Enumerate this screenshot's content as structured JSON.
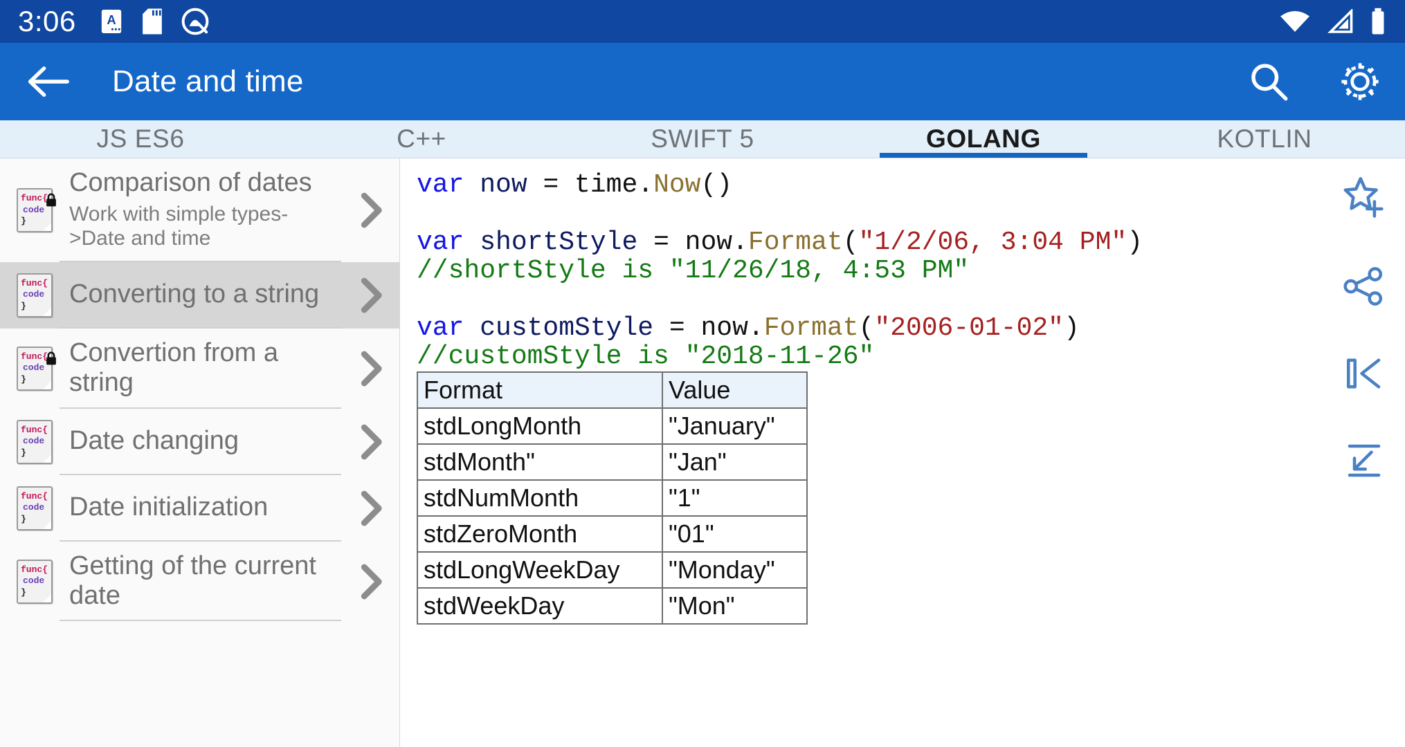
{
  "status_bar": {
    "clock": "3:06",
    "icons": [
      "keyboard-language-icon",
      "sd-card-icon",
      "app-circle-icon"
    ],
    "right_icons": [
      "wifi-icon",
      "cell-signal-icon",
      "battery-icon"
    ],
    "background": "#0F47A1"
  },
  "app_bar": {
    "back_label": "←",
    "title": "Date and time",
    "search_label": "search-icon",
    "settings_label": "gear-icon",
    "background": "#1668C8"
  },
  "tabs": {
    "active_index": 3,
    "accent": "#1565C0",
    "items": [
      {
        "label": "JS ES6"
      },
      {
        "label": "C++"
      },
      {
        "label": "SWIFT 5"
      },
      {
        "label": "GOLANG"
      },
      {
        "label": "KOTLIN"
      }
    ]
  },
  "sidebar": {
    "items": [
      {
        "title": "Comparison of dates",
        "subtitle": "Work with simple types->Date and time",
        "locked": true,
        "selected": false
      },
      {
        "title": "Converting to a string",
        "subtitle": "",
        "locked": false,
        "selected": true
      },
      {
        "title": "Convertion from a string",
        "subtitle": "",
        "locked": true,
        "selected": false
      },
      {
        "title": "Date changing",
        "subtitle": "",
        "locked": false,
        "selected": false
      },
      {
        "title": "Date initialization",
        "subtitle": "",
        "locked": false,
        "selected": false
      },
      {
        "title": "Getting of the current date",
        "subtitle": "",
        "locked": false,
        "selected": false
      }
    ],
    "icon_lines": {
      "l1": "func{",
      "l2": "code",
      "l3": "}"
    },
    "chevron": "chevron-right-icon"
  },
  "code": {
    "language": "GOLANG",
    "lines": [
      [
        {
          "t": "var ",
          "c": "kw"
        },
        {
          "t": "now ",
          "c": "id"
        },
        {
          "t": "= ",
          "c": "pl"
        },
        {
          "t": "time.",
          "c": "pl"
        },
        {
          "t": "Now",
          "c": "fn"
        },
        {
          "t": "()",
          "c": "pl"
        }
      ],
      [],
      [
        {
          "t": "var ",
          "c": "kw"
        },
        {
          "t": "shortStyle ",
          "c": "id"
        },
        {
          "t": "= ",
          "c": "pl"
        },
        {
          "t": "now.",
          "c": "pl"
        },
        {
          "t": "Format",
          "c": "fn"
        },
        {
          "t": "(",
          "c": "pl"
        },
        {
          "t": "\"1/2/06, 3:04 PM\"",
          "c": "str"
        },
        {
          "t": ")",
          "c": "pl"
        }
      ],
      [
        {
          "t": "//shortStyle is \"11/26/18, 4:53 PM\"",
          "c": "cmt"
        }
      ],
      [],
      [
        {
          "t": "var ",
          "c": "kw"
        },
        {
          "t": "customStyle ",
          "c": "id"
        },
        {
          "t": "= ",
          "c": "pl"
        },
        {
          "t": "now.",
          "c": "pl"
        },
        {
          "t": "Format",
          "c": "fn"
        },
        {
          "t": "(",
          "c": "pl"
        },
        {
          "t": "\"2006-01-02\"",
          "c": "str"
        },
        {
          "t": ")",
          "c": "pl"
        }
      ],
      [
        {
          "t": "//customStyle is \"2018-11-26\"",
          "c": "cmt"
        }
      ]
    ]
  },
  "format_table": {
    "headers": [
      "Format",
      "Value"
    ],
    "rows": [
      [
        "stdLongMonth",
        "\"January\""
      ],
      [
        "stdMonth\"",
        "\"Jan\""
      ],
      [
        "stdNumMonth",
        "\"1\""
      ],
      [
        "stdZeroMonth",
        "\"01\""
      ],
      [
        "stdLongWeekDay",
        "\"Monday\""
      ],
      [
        "stdWeekDay",
        "\"Mon\""
      ]
    ]
  },
  "action_rail": {
    "accent": "#4A80C4",
    "buttons": [
      {
        "name": "add-to-favorites-icon"
      },
      {
        "name": "share-icon"
      },
      {
        "name": "skip-to-first-icon"
      },
      {
        "name": "jump-to-bottom-icon"
      }
    ]
  }
}
